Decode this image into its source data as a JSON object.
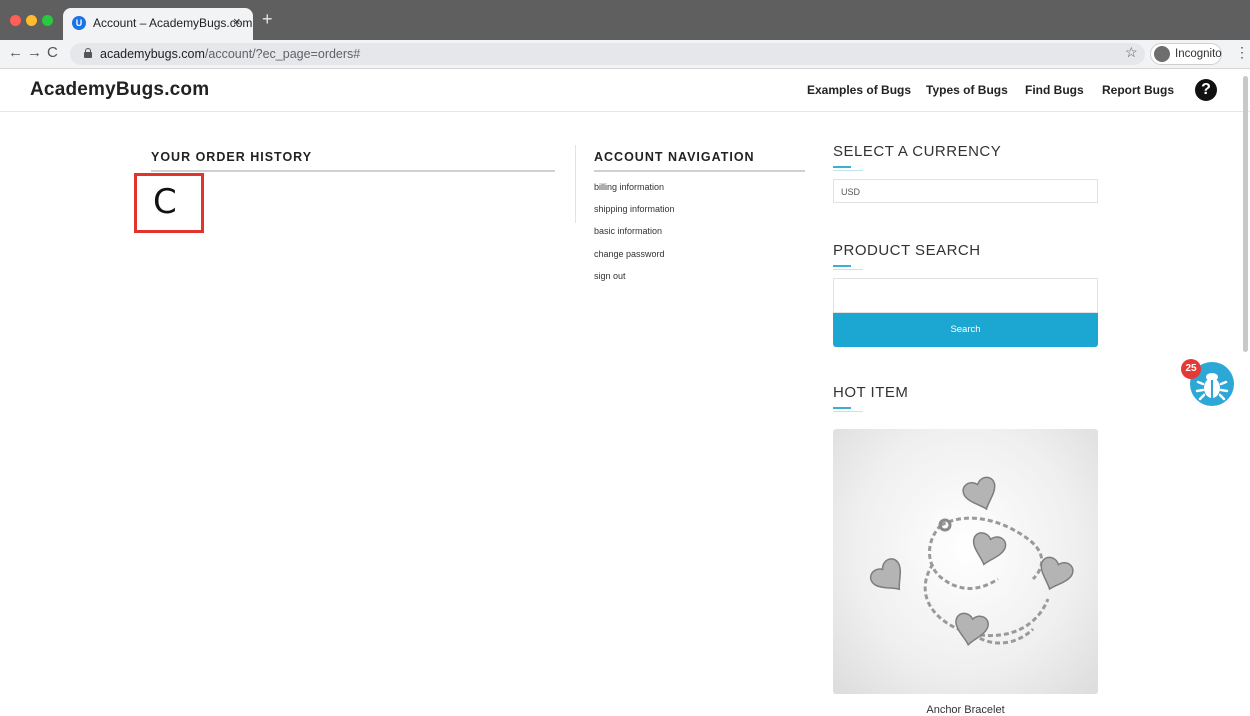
{
  "browser": {
    "tab_title": "Account – AcademyBugs.com",
    "tab_close": "×",
    "new_tab": "+",
    "url_domain": "academybugs.com",
    "url_path": "/account/?ec_page=orders#",
    "incognito_label": "Incognito",
    "nav_back": "←",
    "nav_forward": "→",
    "nav_reload": "C",
    "star": "☆",
    "menu": "⋮",
    "favicon_letter": "U"
  },
  "site": {
    "logo": "AcademyBugs.com",
    "nav": [
      "Examples of Bugs",
      "Types of Bugs",
      "Find Bugs",
      "Report Bugs"
    ],
    "help": "?"
  },
  "orders": {
    "heading": "YOUR ORDER HISTORY",
    "content": "C"
  },
  "account_nav": {
    "heading": "ACCOUNT NAVIGATION",
    "links": [
      "billing information",
      "shipping information",
      "basic information",
      "change password",
      "sign out"
    ]
  },
  "sidebar": {
    "currency_heading": "SELECT A CURRENCY",
    "currency_value": "USD",
    "search_heading": "PRODUCT SEARCH",
    "search_button": "Search",
    "hot_item_heading": "HOT ITEM",
    "hot_item_name": "Anchor Bracelet"
  },
  "bug_widget": {
    "count": "25"
  },
  "colors": {
    "accent": "#1ba7d1",
    "highlight_border": "#e0342c",
    "badge": "#e53935"
  }
}
